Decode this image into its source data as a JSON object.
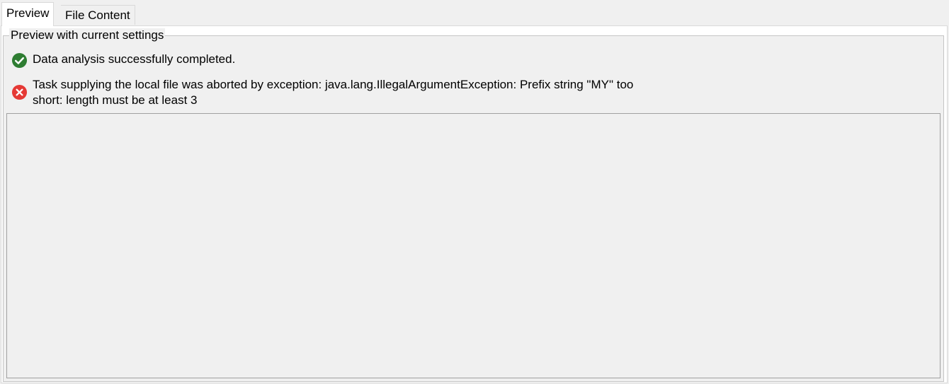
{
  "tabs": [
    {
      "label": "Preview",
      "selected": true
    },
    {
      "label": "File Content",
      "selected": false
    }
  ],
  "group": {
    "title": "Preview with current settings"
  },
  "messages": {
    "success": {
      "icon": "check-circle-icon",
      "color": "#2e7d32",
      "text": "Data analysis successfully completed."
    },
    "error": {
      "icon": "error-circle-icon",
      "color": "#e53935",
      "line1": "Task supplying the local file was aborted by exception: java.lang.IllegalArgumentException: Prefix string \"MY\" too",
      "line2": "short: length must be at least 3"
    }
  }
}
